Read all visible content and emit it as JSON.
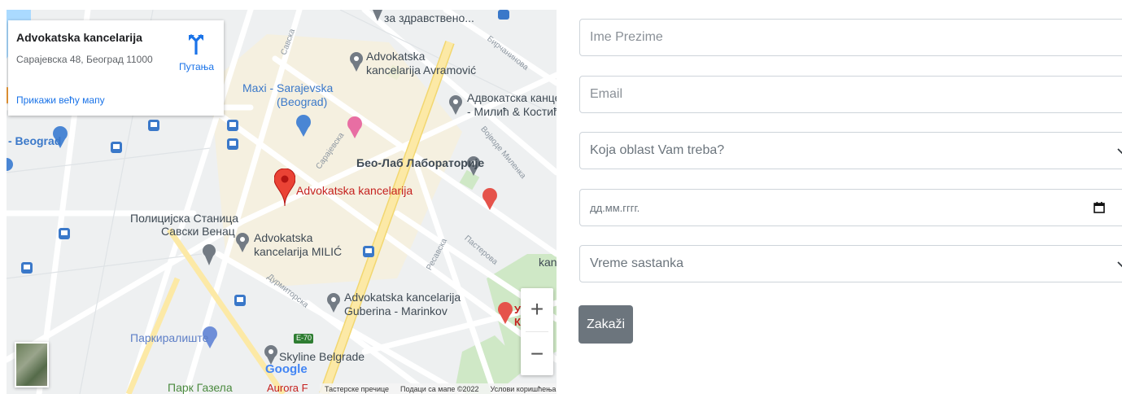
{
  "map": {
    "place_card": {
      "title": "Advokatska kancelarija",
      "address": "Сарајевска 48, Београд 11000",
      "directions_label": "Путања",
      "larger_map_link": "Прикажи већу мапу"
    },
    "labels": {
      "health": "за здравствено...",
      "avramovic_1": "Advokatska",
      "avramovic_2": "kancelarija Avramović",
      "maxi_1": "Maxi - Sarajevska",
      "maxi_2": "(Beograd)",
      "milic_kostic_1": "Адвокатска канцел",
      "milic_kostic_2": "- Милић & Костић",
      "beograd": "- Beograd",
      "beolab": "Бео-Лаб Лабораторије",
      "main_marker": "Advokatska kancelarija",
      "police_1": "Полицијска Станица",
      "police_2": "Савски Венац",
      "milic_1": "Advokatska",
      "milic_2": "kancelarija MILIĆ",
      "kanc": "kanc",
      "guberina_1": "Advokatska kancelarija",
      "guberina_2": "Guberina - Marinkov",
      "parking": "Паркиралиште",
      "skyline": "Skyline Belgrade",
      "park": "Парк Газела",
      "aurora": "Aurora F",
      "uz_1": "У",
      "uz_2": "К",
      "e70": "E-70",
      "google": "Google"
    },
    "streets": {
      "savska": "Савска",
      "sarajevska": "Сарајевска",
      "birchaninova": "Бирчанинова",
      "vojvode_milenka": "Војводе Миленка",
      "resavska": "Ресавска",
      "pasterova": "Пастерова",
      "durmitorska": "Дурмиторска"
    },
    "zoom_in": "+",
    "zoom_out": "−",
    "footer": {
      "shortcuts": "Тастерске пречице",
      "data": "Подаци са мапе ©2022",
      "terms": "Услови коришћења"
    }
  },
  "form": {
    "name_placeholder": "Ime Prezime",
    "email_placeholder": "Email",
    "area_select": "Koja oblast Vam treba?",
    "date_placeholder": "дд.мм.гггг.",
    "time_select": "Vreme sastanka",
    "submit_label": "Zakaži"
  },
  "colors": {
    "accent": "#1a73e8",
    "marker": "#ea4335",
    "button": "#6c757d",
    "major_road": "#fce9a6"
  }
}
